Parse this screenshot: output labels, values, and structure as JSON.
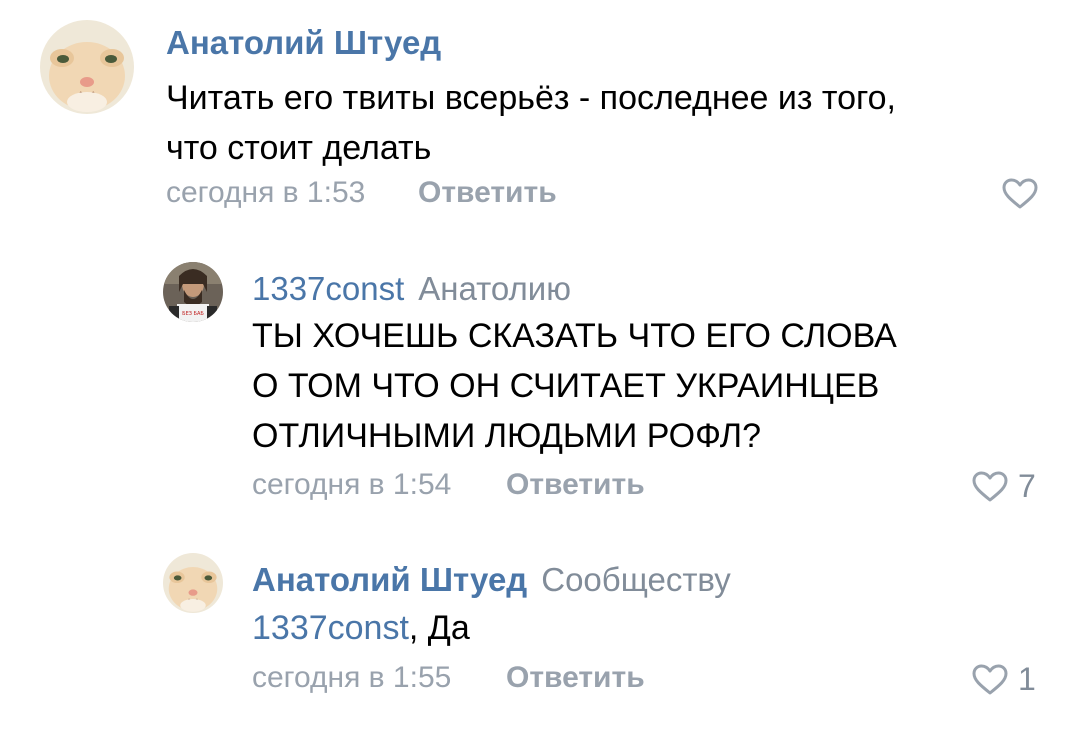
{
  "comments": [
    {
      "author": "Анатолий Штуед",
      "reply_to": "",
      "text_lines": [
        "Читать его твиты всерьёз - последнее из того,",
        "что стоит делать"
      ],
      "date": "сегодня в 1:53",
      "reply_label": "Ответить",
      "likes": ""
    },
    {
      "author": "1337const",
      "reply_to": "Анатолию",
      "text_lines": [
        "ТЫ ХОЧЕШЬ СКАЗАТЬ ЧТО ЕГО СЛОВА",
        "О ТОМ ЧТО ОН СЧИТАЕТ УКРАИНЦЕВ",
        "ОТЛИЧНЫМИ ЛЮДЬМИ РОФЛ?"
      ],
      "date": "сегодня в 1:54",
      "reply_label": "Ответить",
      "likes": "7",
      "avatar_shirt_text": "БЕЗ БАБ"
    },
    {
      "author": "Анатолий Штуед",
      "reply_to": "Сообществу",
      "mention": "1337const",
      "text_rest": ", Да",
      "date": "сегодня в 1:55",
      "reply_label": "Ответить",
      "likes": "1"
    }
  ],
  "icons": {
    "like": "heart-outline-icon"
  },
  "colors": {
    "link": "#4a76a8",
    "secondary": "#99a2ad",
    "text": "#000000"
  }
}
